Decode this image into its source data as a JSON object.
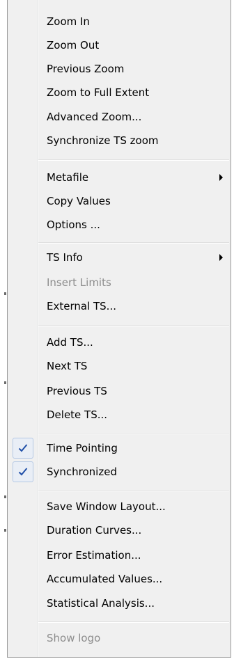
{
  "menu": {
    "zoom_in": "Zoom In",
    "zoom_out": "Zoom Out",
    "previous_zoom": "Previous Zoom",
    "zoom_full_extent": "Zoom to Full Extent",
    "advanced_zoom": "Advanced Zoom...",
    "synchronize_ts_zoom": "Synchronize TS zoom",
    "metafile": "Metafile",
    "copy_values": "Copy Values",
    "options": "Options ...",
    "ts_info": "TS Info",
    "insert_limits": "Insert Limits",
    "external_ts": "External TS...",
    "add_ts": "Add TS...",
    "next_ts": "Next TS",
    "previous_ts": "Previous TS",
    "delete_ts": "Delete TS...",
    "time_pointing": "Time Pointing",
    "synchronized": "Synchronized",
    "save_window_layout": "Save Window Layout...",
    "duration_curves": "Duration Curves...",
    "error_estimation": "Error Estimation...",
    "accumulated_values": "Accumulated Values...",
    "statistical_analysis": "Statistical Analysis...",
    "show_logo": "Show logo"
  },
  "state": {
    "time_pointing_checked": true,
    "synchronized_checked": true,
    "insert_limits_enabled": false,
    "show_logo_enabled": false
  },
  "icons": {
    "submenu": "submenu-arrow-icon",
    "check": "checkmark-icon"
  },
  "colors": {
    "menu_bg": "#f0f0f0",
    "disabled_text": "#8d8d8d",
    "check_blue": "#1f4fa8"
  }
}
